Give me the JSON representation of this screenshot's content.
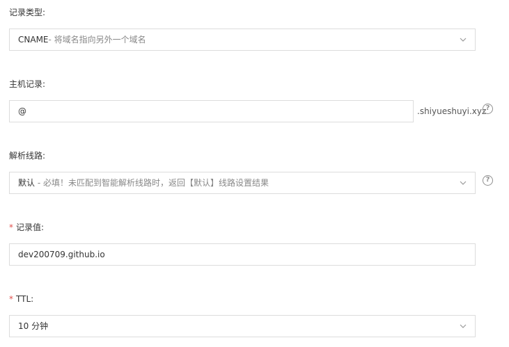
{
  "record_type": {
    "label": "记录类型:",
    "value_main": "CNAME",
    "value_hint": "- 将域名指向另外一个域名",
    "chevron_icon": "chevron-down-icon"
  },
  "host_record": {
    "label": "主机记录:",
    "value": "@",
    "suffix": ".shiyueshuyi.xyz",
    "help_icon": "question-circle-icon"
  },
  "line": {
    "label": "解析线路:",
    "value_main": "默认",
    "value_hint": " - 必填！未匹配到智能解析线路时，返回【默认】线路设置结果",
    "chevron_icon": "chevron-down-icon",
    "help_icon": "question-circle-icon"
  },
  "record_value": {
    "required_mark": "*",
    "label": "记录值:",
    "value": "dev200709.github.io"
  },
  "ttl": {
    "required_mark": "*",
    "label": "TTL:",
    "value": "10 分钟",
    "chevron_icon": "chevron-down-icon"
  }
}
